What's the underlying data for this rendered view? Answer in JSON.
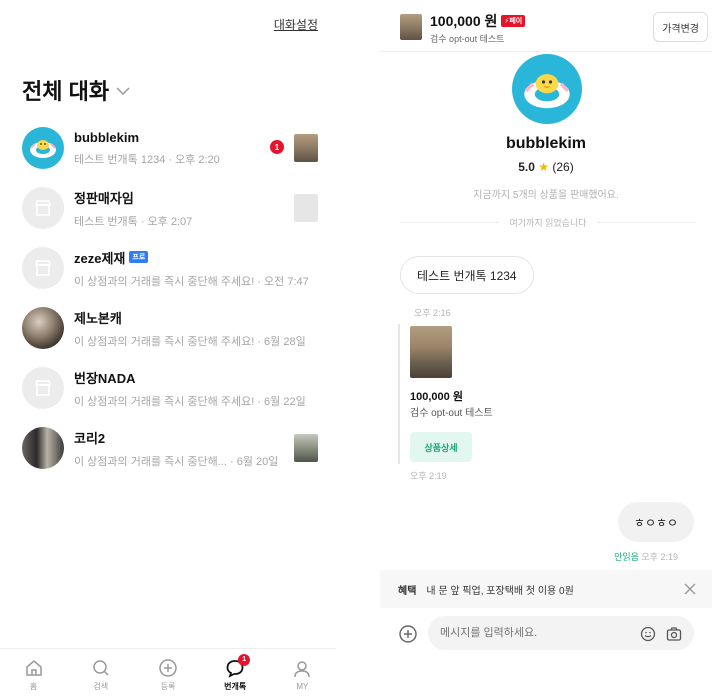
{
  "left": {
    "chat_settings": "대화설정",
    "title": "전체 대화",
    "chats": [
      {
        "name": "bubblekim",
        "badge": "",
        "preview": "테스트 번개톡 1234",
        "time": "오후 2:20",
        "unread": "1",
        "avatar": "bubble",
        "thumb": "t1"
      },
      {
        "name": "정판매자임",
        "badge": "",
        "preview": "테스트 번개톡",
        "time": "오후 2:07",
        "unread": "",
        "avatar": "default",
        "thumb": "t2"
      },
      {
        "name": "zeze제재",
        "badge": "프로",
        "preview": "이 상점과의 거래를 즉시 중단해 주세요!",
        "time": "오전 7:47",
        "unread": "",
        "avatar": "default",
        "thumb": ""
      },
      {
        "name": "제노본캐",
        "badge": "",
        "preview": "이 상점과의 거래를 즉시 중단해 주세요!",
        "time": "6월 28일",
        "unread": "",
        "avatar": "photo1",
        "thumb": ""
      },
      {
        "name": "번장NADA",
        "badge": "",
        "preview": "이 상점과의 거래를 즉시 중단해 주세요!",
        "time": "6월 22일",
        "unread": "",
        "avatar": "default",
        "thumb": ""
      },
      {
        "name": "코리2",
        "badge": "",
        "preview": "이 상점과의 거래를 즉시 중단해...",
        "time": "6월 20일",
        "unread": "",
        "avatar": "photo2",
        "thumb": "t3"
      }
    ],
    "nav": [
      {
        "label": "홈",
        "icon": "home-icon",
        "active": false,
        "badge": ""
      },
      {
        "label": "검색",
        "icon": "search-icon",
        "active": false,
        "badge": ""
      },
      {
        "label": "등록",
        "icon": "plus-circle-icon",
        "active": false,
        "badge": ""
      },
      {
        "label": "번개톡",
        "icon": "chat-icon",
        "active": true,
        "badge": "1"
      },
      {
        "label": "MY",
        "icon": "person-icon",
        "active": false,
        "badge": ""
      }
    ]
  },
  "right": {
    "product": {
      "price": "100,000 원",
      "pay_badge": "페이",
      "name": "검수 opt-out 테스트",
      "price_change": "가격변경"
    },
    "seller": {
      "name": "bubblekim",
      "score": "5.0",
      "count": "(26)",
      "sold_info": "지금까지 5개의 상품을 판매했어요."
    },
    "read_divider": "여기까지 읽었습니다",
    "messages": {
      "incoming_text": "테스트 번개톡 1234",
      "incoming_time": "오후 2:16",
      "card_price": "100,000 원",
      "card_name": "검수 opt-out 테스트",
      "card_button": "상품상세",
      "card_time": "오후 2:19",
      "outgoing_text": "ㅎㅇㅎㅇ",
      "outgoing_status": "안읽음",
      "outgoing_time": "오후 2:19"
    },
    "benefit": {
      "tag": "혜택",
      "text": "내 문 앞 픽업, 포장택배 첫 이용 0원"
    },
    "input": {
      "placeholder": "메시지를 입력하세요."
    }
  },
  "colors": {
    "accent_red": "#e5142a",
    "accent_green": "#1aa67a",
    "avatar_blue": "#29b6d8",
    "badge_blue": "#2f7df6"
  }
}
